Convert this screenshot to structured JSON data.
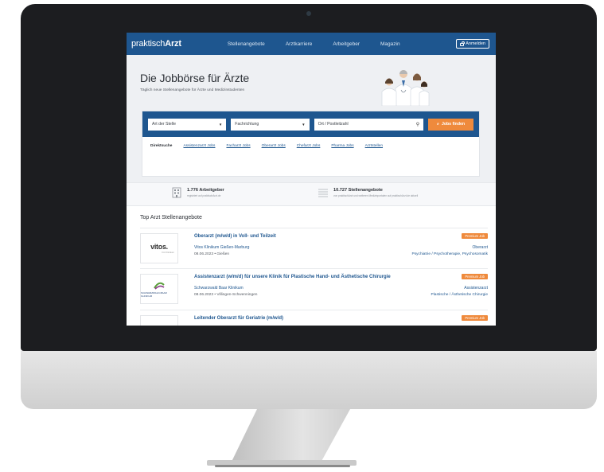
{
  "nav": {
    "logo_regular": "praktisch",
    "logo_bold": "Arzt",
    "links": [
      "Stellenangebote",
      "Arztkarriere",
      "Arbeitgeber",
      "Magazin"
    ],
    "login_label": "Anmelden"
  },
  "hero": {
    "title": "Die Jobbörse für Ärzte",
    "subtitle": "Täglich neue Stellenangebote für Ärzte und Medizinstudenten"
  },
  "search": {
    "position_select": "Art der Stelle",
    "specialty_select": "Fachrichtung",
    "location_placeholder": "Ort / Postleitzahl",
    "button_label": "Jobs finden"
  },
  "quick": {
    "label": "Direktsuche",
    "links": [
      "Assistenzarzt Jobs",
      "Facharzt Jobs",
      "Oberarzt Jobs",
      "Chefarzt Jobs",
      "Pharma Jobs",
      "Arztstellen"
    ]
  },
  "stats": [
    {
      "title": "1.776 Arbeitgeber",
      "desc": "registriert auf praktischArzt.de"
    },
    {
      "title": "10.727 Stellenangebote",
      "desc": "von praktischArzt und weiteren Medizinportalen auf praktischArzt.de aktuell"
    }
  ],
  "list": {
    "heading": "Top Arzt Stellenangebote",
    "jobs": [
      {
        "title": "Oberarzt (m/w/d) in Voll- und Teilzeit",
        "company": "Vitos Klinikum Gießen-Marburg",
        "meta": "08.06.2023 • Gießen",
        "badge": "Premium Job",
        "position": "Oberarzt",
        "field": "Psychiatrie / Psychotherapie, Psychosomatik",
        "logo_text": "vitos.",
        "logo_sub": "Für Klinikum"
      },
      {
        "title": "Assistenzarzt (w/m/d) für unsere Klinik für Plastische Hand- und Ästhetische Chirurgie",
        "company": "Schwarzwald Baar Klinikum",
        "meta": "08.06.2023 • Villingen-Schwenningen",
        "badge": "Premium Job",
        "position": "Assistenzarzt",
        "field": "Plastische / Ästhetische Chirurgie",
        "logo_text": "SCHWARZWALD-BAAR KLINIKUM"
      },
      {
        "title": "Leitender Oberarzt für Geriatrie (m/w/d)",
        "badge": "Premium Job"
      }
    ]
  },
  "colors": {
    "brand_blue": "#1e568f",
    "accent_orange": "#ef8a3c"
  }
}
